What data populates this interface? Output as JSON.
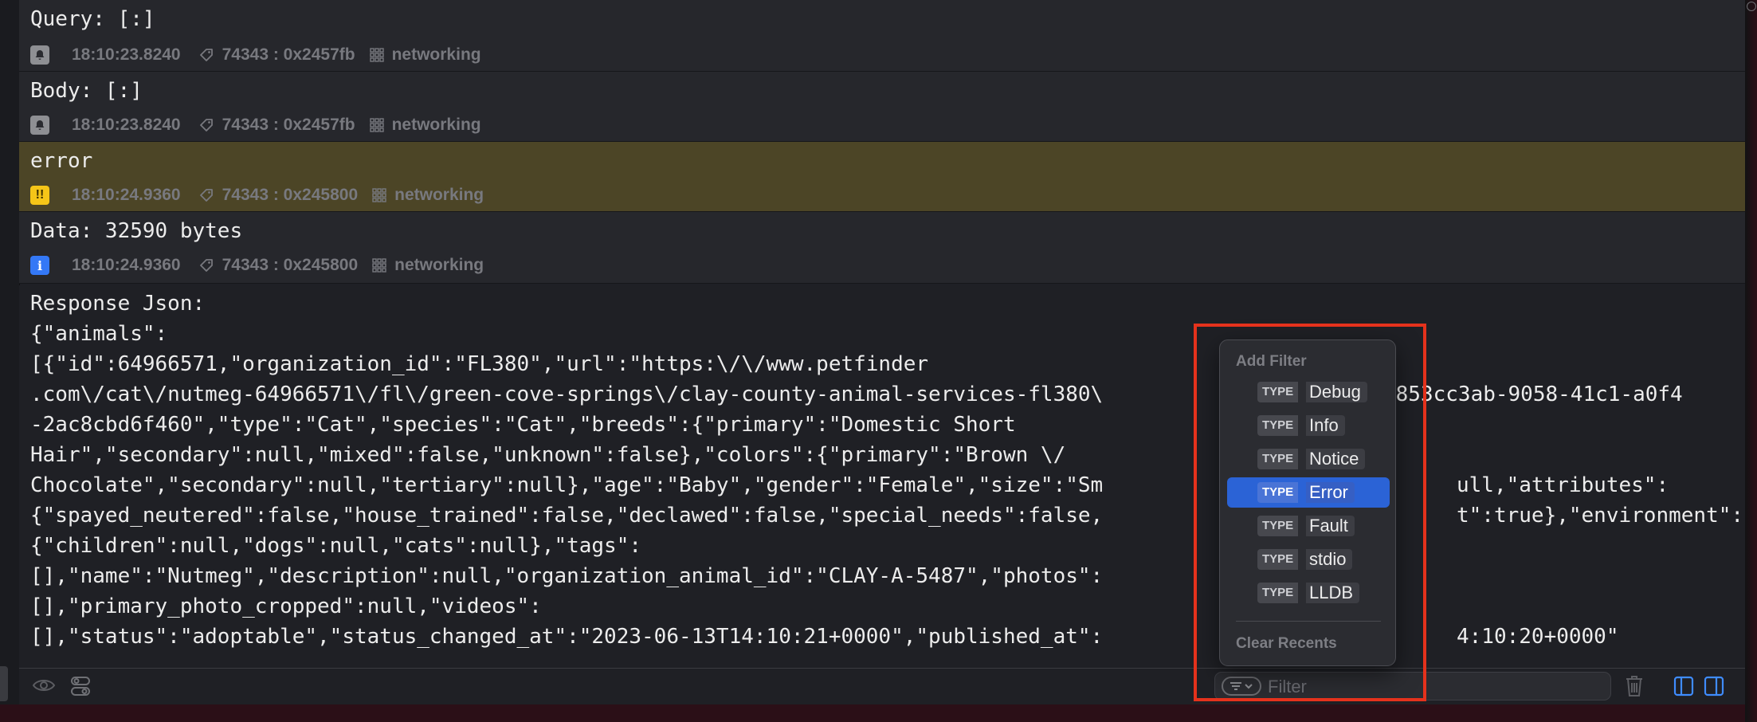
{
  "entries": [
    {
      "message": "Query: [:]",
      "level": "debug",
      "time": "18:10:23.8240",
      "pid_thread": "74343 : 0x2457fb",
      "category": "networking"
    },
    {
      "message": "Body: [:]",
      "level": "debug",
      "time": "18:10:23.8240",
      "pid_thread": "74343 : 0x2457fb",
      "category": "networking"
    },
    {
      "message": "error",
      "level": "error",
      "time": "18:10:24.9360",
      "pid_thread": "74343 : 0x245800",
      "category": "networking"
    },
    {
      "message": "Data: 32590 bytes",
      "level": "info",
      "time": "18:10:24.9360",
      "pid_thread": "74343 : 0x245800",
      "category": "networking"
    }
  ],
  "badge_glyphs": {
    "error": "!!",
    "info": "i"
  },
  "response_json": {
    "lines": [
      "Response Json:",
      "{\"animals\":",
      "[{\"id\":64966571,\"organization_id\":\"FL380\",\"url\":\"https:\\/\\/www.petfinder",
      ".com\\/cat\\/nutmeg-64966571\\/fl\\/green-cove-springs\\/clay-county-animal-services-fl380\\",
      "-2ac8cbd6f460\",\"type\":\"Cat\",\"species\":\"Cat\",\"breeds\":{\"primary\":\"Domestic Short",
      "Hair\",\"secondary\":null,\"mixed\":false,\"unknown\":false},\"colors\":{\"primary\":\"Brown \\/",
      "Chocolate\",\"secondary\":null,\"tertiary\":null},\"age\":\"Baby\",\"gender\":\"Female\",\"size\":\"Sm",
      "{\"spayed_neutered\":false,\"house_trained\":false,\"declawed\":false,\"special_needs\":false,",
      "{\"children\":null,\"dogs\":null,\"cats\":null},\"tags\":",
      "[],\"name\":\"Nutmeg\",\"description\":null,\"organization_animal_id\":\"CLAY-A-5487\",\"photos\":",
      "[],\"primary_photo_cropped\":null,\"videos\":",
      "[],\"status\":\"adoptable\",\"status_changed_at\":\"2023-06-13T14:10:21+0000\",\"published_at\":"
    ],
    "right_fragments": [
      "=853cc3ab-9058-41c1-a0f4",
      "ull,\"attributes\":",
      "t\":true},\"environment\":",
      "4:10:20+0000\""
    ]
  },
  "filter_menu": {
    "heading": "Add Filter",
    "type_label": "TYPE",
    "items": [
      "Debug",
      "Info",
      "Notice",
      "Error",
      "Fault",
      "stdio",
      "LLDB"
    ],
    "selected": "Error",
    "clear_recents": "Clear Recents"
  },
  "filter_field": {
    "placeholder": "Filter",
    "value": ""
  },
  "colors": {
    "error_row": "#4c4526",
    "selection": "#2b63d6",
    "highlight": "#e5321c",
    "sidebar_accent": "#3f8cff"
  }
}
